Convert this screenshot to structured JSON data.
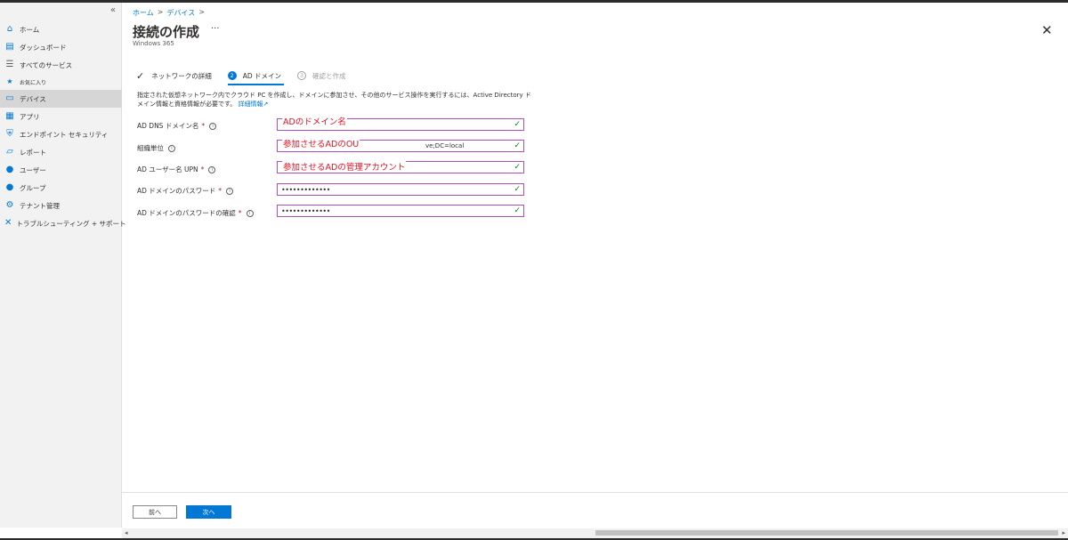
{
  "sidebar": {
    "collapse_glyph": "«",
    "items": [
      {
        "label": "ホーム",
        "icon": "home-icon",
        "glyph": "⌂"
      },
      {
        "label": "ダッシュボード",
        "icon": "dashboard-icon",
        "glyph": "▤"
      },
      {
        "label": "すべてのサービス",
        "icon": "all-services-icon",
        "glyph": "☰"
      },
      {
        "label": "お気に入り",
        "icon": "favorites-star-icon",
        "glyph": "★"
      },
      {
        "label": "デバイス",
        "icon": "devices-icon",
        "glyph": "▭"
      },
      {
        "label": "アプリ",
        "icon": "apps-icon",
        "glyph": "▦"
      },
      {
        "label": "エンドポイント セキュリティ",
        "icon": "endpoint-security-icon",
        "glyph": "⛨"
      },
      {
        "label": "レポート",
        "icon": "reports-icon",
        "glyph": "▱"
      },
      {
        "label": "ユーザー",
        "icon": "users-icon",
        "glyph": "●"
      },
      {
        "label": "グループ",
        "icon": "groups-icon",
        "glyph": "●"
      },
      {
        "label": "テナント管理",
        "icon": "tenant-admin-icon",
        "glyph": "⚙"
      },
      {
        "label": "トラブルシューティング + サポート",
        "icon": "troubleshooting-icon",
        "glyph": "✕"
      }
    ],
    "active_index": 4
  },
  "breadcrumb": {
    "home": "ホーム",
    "devices": "デバイス",
    "sep": ">"
  },
  "page": {
    "title": "接続の作成",
    "more": "···",
    "subtitle": "Windows 365",
    "close": "✕"
  },
  "steps": [
    {
      "label": "ネットワークの詳細",
      "state": "done",
      "marker": "✓"
    },
    {
      "label": "AD ドメイン",
      "state": "current",
      "marker": "2"
    },
    {
      "label": "確認と作成",
      "state": "future",
      "marker": "3"
    }
  ],
  "description": {
    "text": "指定された仮想ネットワーク内でクラウド PC を作成し、ドメインに参加させ、その他のサービス操作を実行するには、Active Directory ドメイン情報と資格情報が必要です。",
    "link": "詳細情報"
  },
  "form": {
    "fields": [
      {
        "label": "AD DNS ドメイン名",
        "required": true,
        "value": ""
      },
      {
        "label": "組織単位",
        "required": false,
        "value": "ve;DC=local"
      },
      {
        "label": "AD ユーザー名 UPN",
        "required": true,
        "value": ""
      },
      {
        "label": "AD ドメインのパスワード",
        "required": true,
        "value": "•••••••••••••"
      },
      {
        "label": "AD ドメインのパスワードの確認",
        "required": true,
        "value": "•••••••••••••"
      }
    ],
    "required_mark": "*",
    "info_glyph": "i",
    "valid_glyph": "✓"
  },
  "annotations": [
    "ADのドメイン名",
    "参加させるADのOU",
    "参加させるADの管理アカウント"
  ],
  "footer": {
    "prev": "前へ",
    "next": "次へ"
  },
  "scrollbar": {
    "left": "◂",
    "right": "▸"
  },
  "colors": {
    "accent": "#0078d4",
    "annotation": "#e81123",
    "field_border": "#b24fbf",
    "valid": "#107c10"
  }
}
